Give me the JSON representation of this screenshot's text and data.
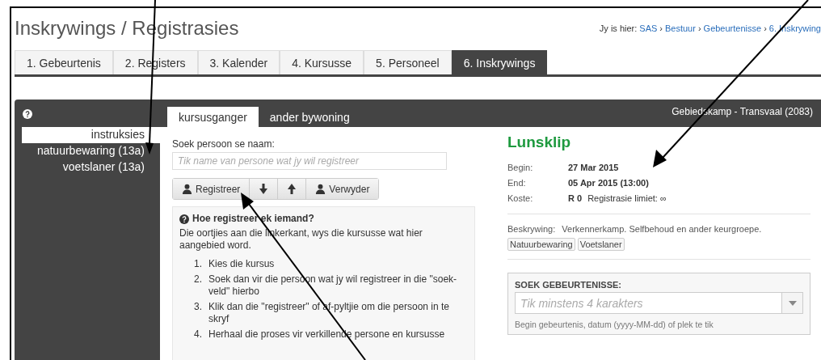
{
  "page": {
    "title": "Inskrywings / Registrasies",
    "breadcrumb_label": "Jy is hier:",
    "separator": "›",
    "breadcrumb": [
      "SAS",
      "Bestuur",
      "Gebeurtenisse",
      "6. Inskrywing"
    ]
  },
  "tabs": [
    {
      "label": "1. Gebeurtenis",
      "selected": false
    },
    {
      "label": "2. Registers",
      "selected": false
    },
    {
      "label": "3. Kalender",
      "selected": false
    },
    {
      "label": "4. Kursusse",
      "selected": false
    },
    {
      "label": "5. Personeel",
      "selected": false
    },
    {
      "label": "6. Inskrywings",
      "selected": true
    }
  ],
  "panel": {
    "context": "Gebiedskamp - Transvaal (2083)",
    "sidebar": [
      {
        "label": "instruksies",
        "selected": true
      },
      {
        "label": "natuurbewaring (13a)",
        "selected": false
      },
      {
        "label": "voetslaner (13a)",
        "selected": false
      }
    ],
    "tabs": [
      {
        "label": "kursusganger",
        "selected": true
      },
      {
        "label": "ander bywoning",
        "selected": false
      }
    ],
    "search": {
      "label": "Soek persoon se naam:",
      "placeholder": "Tik name van persone wat jy wil registreer"
    },
    "buttons": [
      {
        "kind": "person",
        "label": "Registreer"
      },
      {
        "kind": "down"
      },
      {
        "kind": "up"
      },
      {
        "kind": "person",
        "label": "Verwyder"
      }
    ],
    "help": {
      "title": "Hoe registreer ek iemand?",
      "intro": "Die oortjies aan die linkerkant, wys die kursusse wat hier aangebied word.",
      "steps": [
        {
          "number": "1.",
          "text": "Kies die kursus"
        },
        {
          "number": "2.",
          "text": "Soek dan vir die persoon wat jy wil registreer in die \"soek-veld\" hierbo"
        },
        {
          "number": "3.",
          "text": "Klik dan die \"registreer\" of af-pyltjie om die persoon in te skryf"
        },
        {
          "number": "4.",
          "text": "Herhaal die proses vir verkillende persone en kursusse"
        }
      ]
    },
    "event": {
      "name": "Lunsklip",
      "details": [
        {
          "label": "Begin:",
          "value": "27 Mar 2015"
        },
        {
          "label": "End:",
          "value": "05 Apr 2015 (13:00)"
        },
        {
          "label": "Koste:",
          "value": "R 0",
          "extra": "Registrasie limiet: ∞"
        }
      ],
      "description_label": "Beskrywing:",
      "description": "Verkennerkamp. Selfbehoud en ander keurgroepe.",
      "tags": [
        "Natuurbewaring",
        "Voetslaner"
      ]
    },
    "event_search": {
      "label": "SOEK GEBEURTENISSE:",
      "placeholder": "Tik minstens 4 karakters",
      "hint": "Begin gebeurtenis, datum (yyyy-MM-dd) of plek te tik"
    }
  }
}
